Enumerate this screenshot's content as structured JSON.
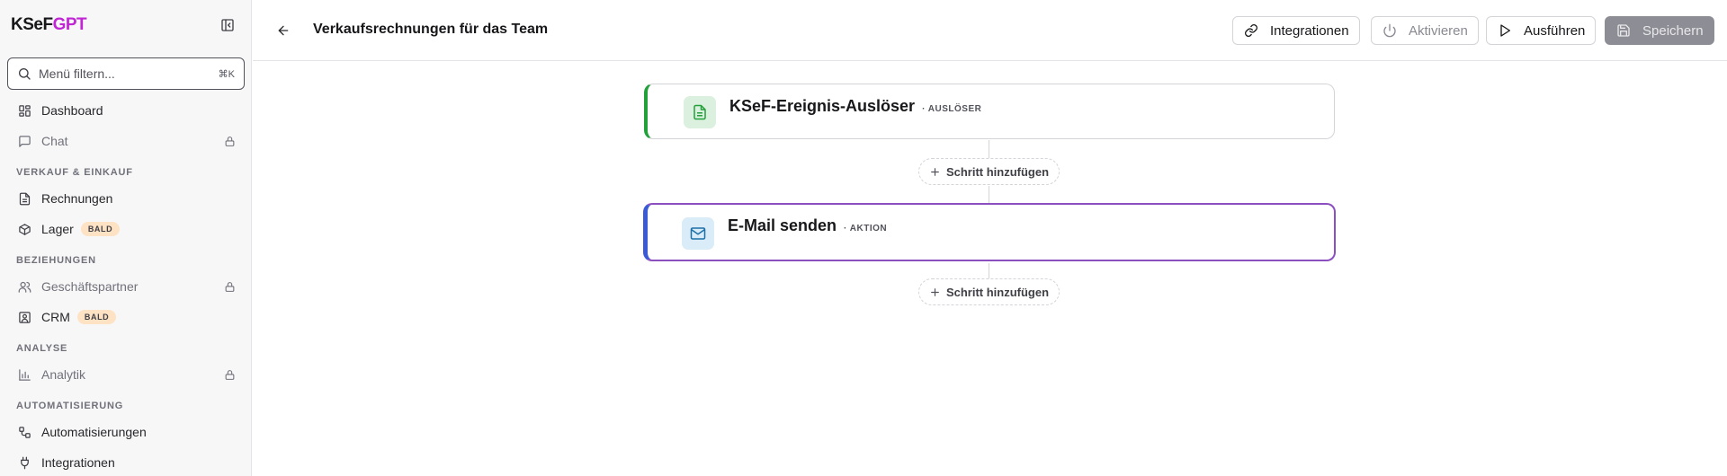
{
  "brand": {
    "part1": "KSeF",
    "part2": "GPT"
  },
  "filter": {
    "placeholder": "Menü filtern...",
    "shortcut": "⌘K"
  },
  "sidebar": {
    "items": [
      {
        "label": "Dashboard",
        "icon": "dashboard-icon"
      },
      {
        "label": "Chat",
        "icon": "chat-icon",
        "locked": true
      }
    ],
    "sections": [
      {
        "title": "VERKAUF & EINKAUF",
        "items": [
          {
            "label": "Rechnungen",
            "icon": "file-text-icon"
          },
          {
            "label": "Lager",
            "icon": "package-icon",
            "badge": "BALD"
          }
        ]
      },
      {
        "title": "BEZIEHUNGEN",
        "items": [
          {
            "label": "Geschäftspartner",
            "icon": "users-icon",
            "locked": true
          },
          {
            "label": "CRM",
            "icon": "contact-icon",
            "badge": "BALD"
          }
        ]
      },
      {
        "title": "ANALYSE",
        "items": [
          {
            "label": "Analytik",
            "icon": "bar-chart-icon",
            "locked": true
          }
        ]
      },
      {
        "title": "AUTOMATISIERUNG",
        "items": [
          {
            "label": "Automatisierungen",
            "icon": "workflow-icon"
          },
          {
            "label": "Integrationen",
            "icon": "plug-icon"
          }
        ]
      }
    ]
  },
  "header": {
    "title": "Verkaufsrechnungen für das Team",
    "buttons": {
      "integrations": "Integrationen",
      "activate": "Aktivieren",
      "run": "Ausführen",
      "save": "Speichern"
    }
  },
  "workflow": {
    "trigger": {
      "title": "KSeF-Ereignis-Auslöser",
      "tag": "· AUSLÖSER"
    },
    "action": {
      "title": "E-Mail senden",
      "tag": "· AKTION"
    },
    "add_step_label": "Schritt hinzufügen"
  },
  "colors": {
    "brand_accent": "#c026d3",
    "trigger_accent": "#22a03a",
    "action_border": "#8b4fc0",
    "action_accent": "#3b5bd6",
    "badge_bg": "#fde2c4"
  }
}
